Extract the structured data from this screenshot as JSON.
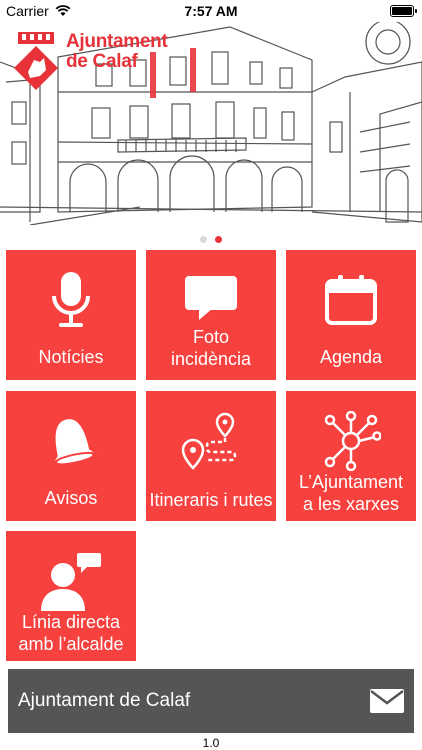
{
  "status_bar": {
    "carrier": "Carrier",
    "time": "7:57 AM"
  },
  "header": {
    "logo_line1": "Ajuntament",
    "logo_line2": "de Calaf"
  },
  "carousel": {
    "slide_count": 2,
    "active_slide": 2
  },
  "tiles": [
    {
      "label": "Notícies",
      "icon": "microphone-icon"
    },
    {
      "label": "Foto incidència",
      "icon": "speech-bubble-icon"
    },
    {
      "label": "Agenda",
      "icon": "calendar-icon"
    },
    {
      "label": "Avisos",
      "icon": "bell-icon"
    },
    {
      "label": "Itineraris i rutes",
      "icon": "route-pin-icon"
    },
    {
      "label": "L’Ajuntament a les xarxes",
      "icon": "network-icon"
    },
    {
      "label": "Línia directa amb l’alcalde",
      "icon": "chat-person-icon"
    }
  ],
  "footer": {
    "title": "Ajuntament de Calaf",
    "icon": "envelope-icon"
  },
  "version": "1.0",
  "colors": {
    "accent": "#f6413f",
    "footer_bg": "#555555"
  }
}
